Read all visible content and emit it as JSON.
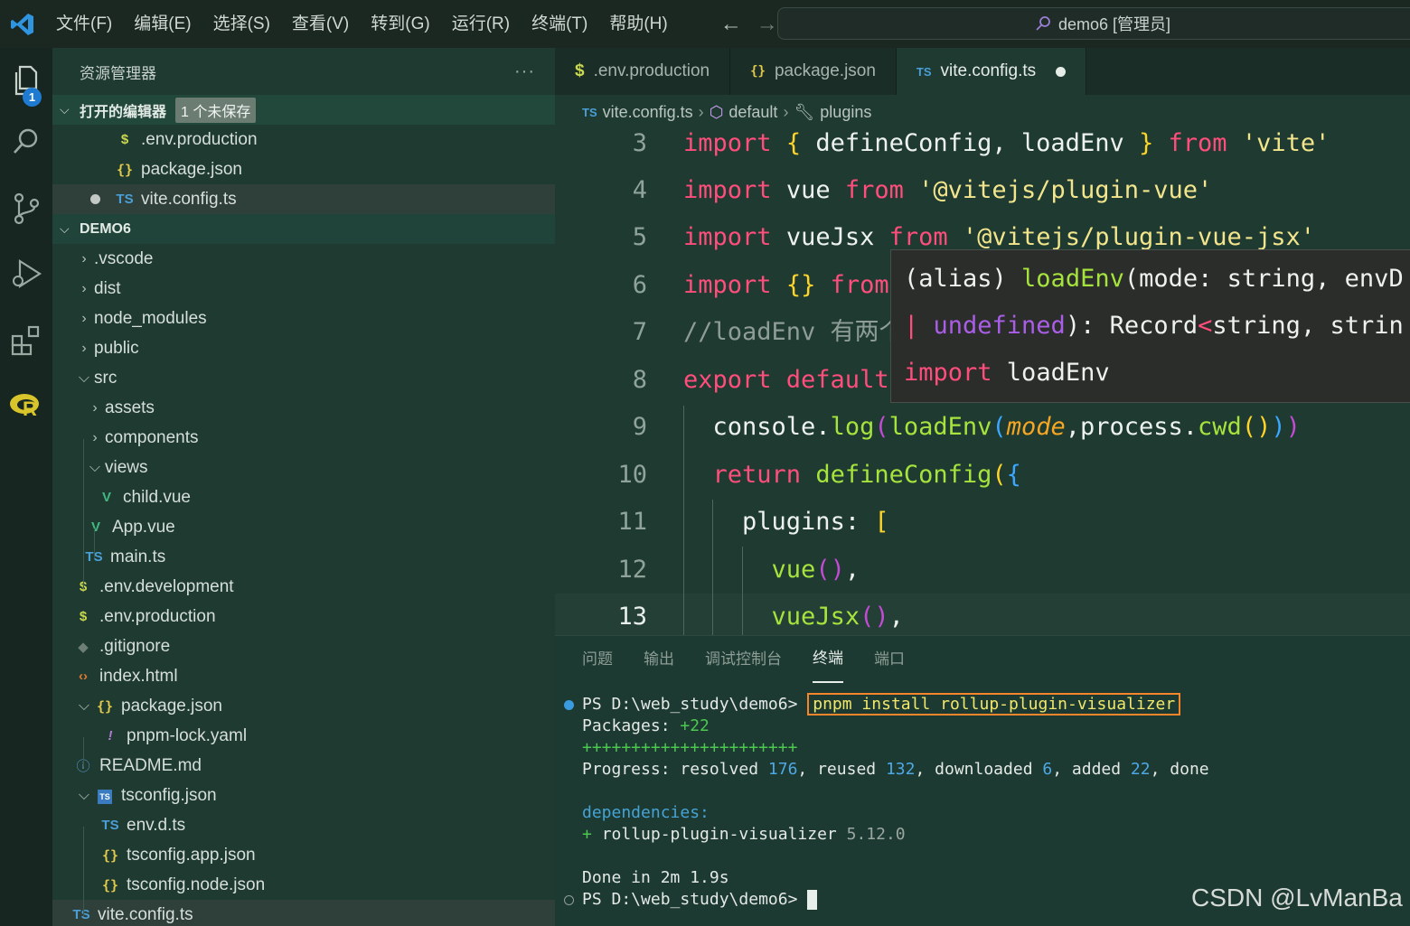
{
  "titlebar": {
    "menus": [
      "文件(F)",
      "编辑(E)",
      "选择(S)",
      "查看(V)",
      "转到(G)",
      "运行(R)",
      "终端(T)",
      "帮助(H)"
    ],
    "search_text": "demo6 [管理员]",
    "back_icon": "arrow-left-icon",
    "forward_icon": "arrow-right-icon"
  },
  "activity": {
    "explorer_badge": "1",
    "icons": [
      "files-icon",
      "search-icon",
      "source-control-icon",
      "run-debug-icon",
      "extensions-icon",
      "r-language-icon"
    ]
  },
  "sidebar": {
    "title": "资源管理器",
    "more": "···",
    "open_editors": {
      "label": "打开的编辑器",
      "badge": "1 个未保存",
      "files": [
        ".env.production",
        "package.json",
        "vite.config.ts"
      ]
    },
    "project": {
      "label": "DEMO6",
      "tree": [
        {
          "name": ".vscode",
          "type": "folder"
        },
        {
          "name": "dist",
          "type": "folder"
        },
        {
          "name": "node_modules",
          "type": "folder"
        },
        {
          "name": "public",
          "type": "folder"
        },
        {
          "name": "src",
          "type": "folder-open"
        },
        {
          "name": "assets",
          "type": "folder"
        },
        {
          "name": "components",
          "type": "folder"
        },
        {
          "name": "views",
          "type": "folder-open"
        },
        {
          "name": "child.vue",
          "type": "vue"
        },
        {
          "name": "App.vue",
          "type": "vue"
        },
        {
          "name": "main.ts",
          "type": "ts"
        },
        {
          "name": ".env.development",
          "type": "env"
        },
        {
          "name": ".env.production",
          "type": "env"
        },
        {
          "name": ".gitignore",
          "type": "git"
        },
        {
          "name": "index.html",
          "type": "html"
        },
        {
          "name": "package.json",
          "type": "json-open"
        },
        {
          "name": "pnpm-lock.yaml",
          "type": "yaml"
        },
        {
          "name": "README.md",
          "type": "info"
        },
        {
          "name": "tsconfig.json",
          "type": "tsconfig-open"
        },
        {
          "name": "env.d.ts",
          "type": "ts"
        },
        {
          "name": "tsconfig.app.json",
          "type": "json"
        },
        {
          "name": "tsconfig.node.json",
          "type": "json"
        },
        {
          "name": "vite.config.ts",
          "type": "ts"
        }
      ]
    }
  },
  "editor": {
    "tabs": [
      {
        "label": ".env.production",
        "icon": "$"
      },
      {
        "label": "package.json",
        "icon": "{}"
      },
      {
        "label": "vite.config.ts",
        "icon": "TS"
      }
    ],
    "breadcrumb": [
      "vite.config.ts",
      "default",
      "plugins"
    ],
    "line_numbers": [
      "3",
      "4",
      "5",
      "6",
      "7",
      "8",
      "9",
      "10",
      "11",
      "12",
      "13"
    ],
    "hover": {
      "line1_a": "(alias) ",
      "line1_b": "loadEnv",
      "line1_c": "(mode: string, envD",
      "line2_a": "| ",
      "line2_b": "undefined",
      "line2_c": "): Record",
      "line2_d": "<",
      "line2_e": "string, strin",
      "line3_a": "import",
      "line3_b": " loadEnv"
    }
  },
  "panel": {
    "tabs": [
      "问题",
      "输出",
      "调试控制台",
      "终端",
      "端口"
    ],
    "active_tab": "终端",
    "terminal": {
      "prompt": "PS D:\\web_study\\demo6> ",
      "command": "pnpm install rollup-plugin-visualizer",
      "packages_label": "Packages: ",
      "packages_value": "+22",
      "plus_bar": "++++++++++++++++++++++",
      "progress_a": "Progress: resolved ",
      "progress_resolved": "176",
      "progress_b": ", reused ",
      "progress_reused": "132",
      "progress_c": ", downloaded ",
      "progress_downloaded": "6",
      "progress_d": ", added ",
      "progress_added": "22",
      "progress_e": ", done",
      "deps_label": "dependencies:",
      "dep_plus": "+ ",
      "dep_name": "rollup-plugin-visualizer ",
      "dep_version": "5.12.0",
      "done_line": "Done in 2m 1.9s",
      "prompt2": "PS D:\\web_study\\demo6> "
    }
  },
  "watermark": "CSDN @LvManBa"
}
